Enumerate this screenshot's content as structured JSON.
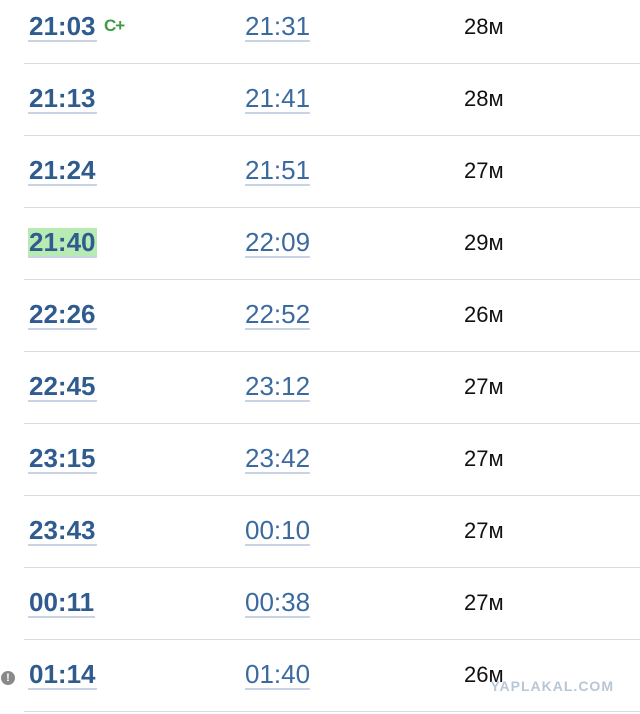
{
  "rows": [
    {
      "departure": "21:03",
      "arrival": "21:31",
      "duration": "28м",
      "badge": "C+",
      "highlight": false,
      "warning": false
    },
    {
      "departure": "21:13",
      "arrival": "21:41",
      "duration": "28м",
      "badge": "",
      "highlight": false,
      "warning": false
    },
    {
      "departure": "21:24",
      "arrival": "21:51",
      "duration": "27м",
      "badge": "",
      "highlight": false,
      "warning": false
    },
    {
      "departure": "21:40",
      "arrival": "22:09",
      "duration": "29м",
      "badge": "",
      "highlight": true,
      "warning": false
    },
    {
      "departure": "22:26",
      "arrival": "22:52",
      "duration": "26м",
      "badge": "",
      "highlight": false,
      "warning": false
    },
    {
      "departure": "22:45",
      "arrival": "23:12",
      "duration": "27м",
      "badge": "",
      "highlight": false,
      "warning": false
    },
    {
      "departure": "23:15",
      "arrival": "23:42",
      "duration": "27м",
      "badge": "",
      "highlight": false,
      "warning": false
    },
    {
      "departure": "23:43",
      "arrival": "00:10",
      "duration": "27м",
      "badge": "",
      "highlight": false,
      "warning": false
    },
    {
      "departure": "00:11",
      "arrival": "00:38",
      "duration": "27м",
      "badge": "",
      "highlight": false,
      "warning": false
    },
    {
      "departure": "01:14",
      "arrival": "01:40",
      "duration": "26м",
      "badge": "",
      "highlight": false,
      "warning": true
    }
  ],
  "warning_icon": "exclamation-circle-icon",
  "watermark": "YAPLAKAL.COM",
  "colors": {
    "link": "#2f5b8f",
    "highlight": "#b8eab4",
    "badge": "#3f9a43"
  }
}
